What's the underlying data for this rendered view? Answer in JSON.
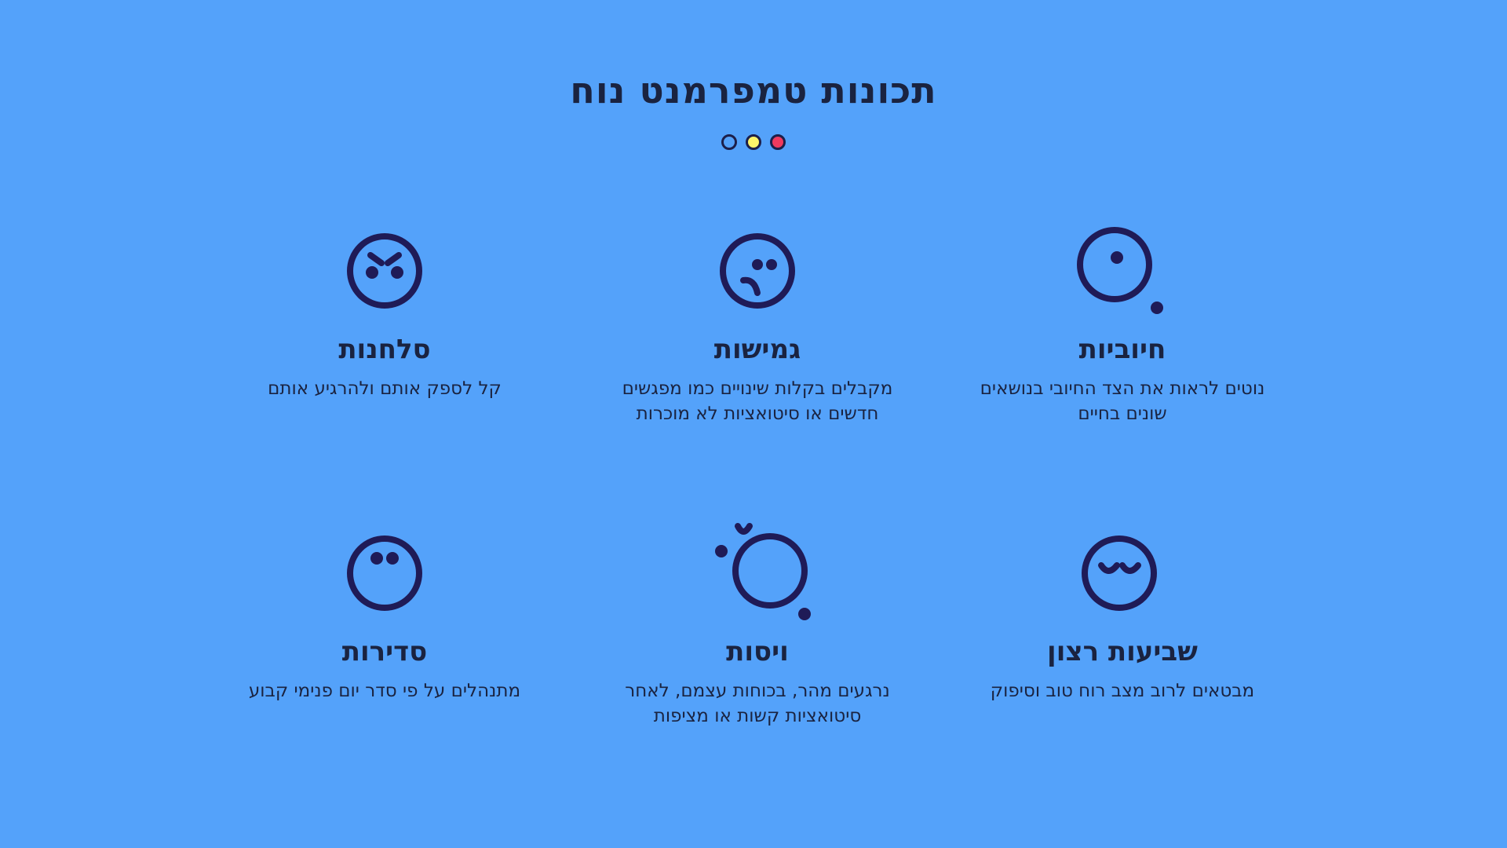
{
  "title": "תכונות טמפרמנט נוח",
  "indicator_colors": [
    "#54a2fa",
    "#fdf46a",
    "#f03a5f"
  ],
  "items": [
    {
      "icon": "positive-face-icon",
      "title": "חיוביות",
      "text": "נוטים לראות את הצד החיובי בנושאים שונים בחיים"
    },
    {
      "icon": "flexible-face-icon",
      "title": "גמישות",
      "text": "מקבלים בקלות שינויים כמו מפגשים חדשים או סיטואציות לא מוכרות"
    },
    {
      "icon": "forgiving-face-icon",
      "title": "סלחנות",
      "text": "קל לספק אותם ולהרגיע אותם"
    },
    {
      "icon": "content-face-icon",
      "title": "שביעות רצון",
      "text": "מבטאים לרוב מצב רוח טוב וסיפוק"
    },
    {
      "icon": "regulation-face-icon",
      "title": "ויסות",
      "text": "נרגעים מהר, בכוחות עצמם, לאחר סיטואציות קשות או מציפות"
    },
    {
      "icon": "regularity-face-icon",
      "title": "סדירות",
      "text": "מתנהלים על פי סדר יום פנימי קבוע"
    }
  ]
}
